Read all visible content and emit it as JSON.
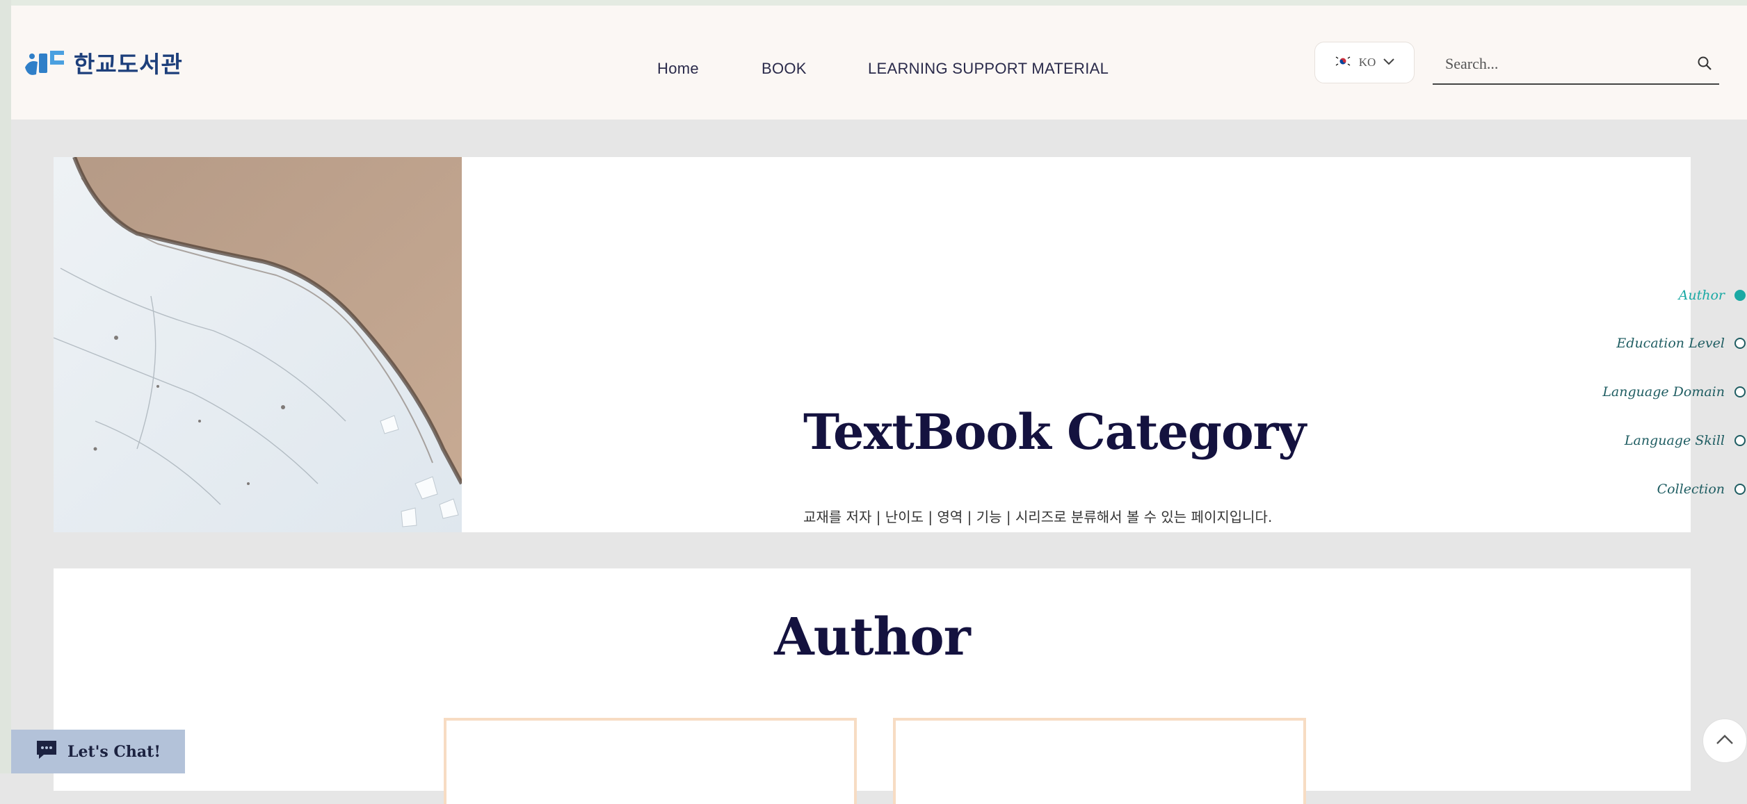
{
  "brand": {
    "logo_text": "한교도서관",
    "logo_mark_text": "한도"
  },
  "nav": [
    {
      "label": "Home"
    },
    {
      "label": "BOOK"
    },
    {
      "label": "LEARNING SUPPORT MATERIAL"
    }
  ],
  "language": {
    "code": "KO",
    "flag": "korea-flag-icon"
  },
  "search": {
    "placeholder": "Search..."
  },
  "hero": {
    "title": "TextBook Category",
    "subtitle": "교재를 저자 | 난이도 | 영역 | 기능 | 시리즈로 분류해서 볼 수 있는 페이지입니다."
  },
  "anchors": [
    {
      "label": "Author",
      "active": true
    },
    {
      "label": "Education Level",
      "active": false
    },
    {
      "label": "Language Domain",
      "active": false
    },
    {
      "label": "Language Skill",
      "active": false
    },
    {
      "label": "Collection",
      "active": false
    }
  ],
  "author_section": {
    "title": "Author"
  },
  "chat": {
    "label": "Let's Chat!"
  },
  "colors": {
    "header_bg": "#fbf7f4",
    "title": "#14123f",
    "anchor_active": "#1aa9a4",
    "anchor": "#1f5d62",
    "chat_bg": "#b3c2d9",
    "card_border": "#f7dcc3"
  }
}
